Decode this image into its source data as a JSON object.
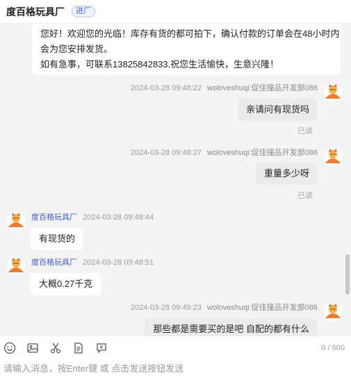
{
  "header": {
    "title": "度百格玩具厂",
    "badge": "进厂"
  },
  "chat": {
    "welcome_lines": [
      "您好！欢迎您的光临！库存有货的都可拍下，确认付款的订单会在48小时内",
      "会为您安排发货。",
      "如有急事，可联系13825842833.祝您生活愉快，生意兴隆！"
    ],
    "messages": [
      {
        "side": "right",
        "time": "2024-03-28 09:48:22",
        "sender": "woloveshuqi:促佳撞品开发部086",
        "text": "亲请问有现货吗",
        "status": "已读"
      },
      {
        "side": "right",
        "time": "2024-03-28 09:48:27",
        "sender": "woloveshuqi:促佳撞品开发部086",
        "text": "重量多少呀",
        "status": "已读"
      },
      {
        "side": "left",
        "sender": "度百格玩具厂",
        "time": "2024-03-28 09:48:44",
        "text": "有现货的"
      },
      {
        "side": "left",
        "sender": "度百格玩具厂",
        "time": "2024-03-28 09:48:51",
        "text": "大概0.27千克"
      },
      {
        "side": "right",
        "time": "2024-03-28 09:49:23",
        "sender": "woloveshuqi:促佳撞品开发部086",
        "text": "那些都是需要买的是吧 自配的都有什么"
      }
    ]
  },
  "toolbar": {
    "icons": [
      "emoji-icon",
      "image-icon",
      "scissors-icon",
      "document-icon",
      "quick-reply-icon"
    ],
    "counter": "0 / 500"
  },
  "input": {
    "placeholder": "请输入消息，按Enter键 或 点击发送按钮发送",
    "value": ""
  },
  "colors": {
    "accent": "#3b5bdb",
    "avatar_orange": "#f07a2d",
    "chat_bg": "#f4f4f4",
    "my_bubble": "#ebebeb"
  }
}
